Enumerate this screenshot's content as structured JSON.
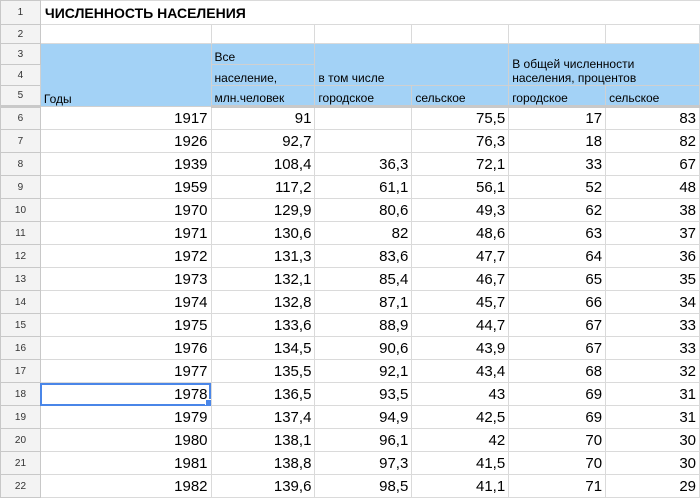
{
  "title": "ЧИСЛЕННОСТЬ НАСЕЛЕНИЯ",
  "row_numbers": [
    "1",
    "2",
    "3",
    "4",
    "5",
    "6",
    "7",
    "8",
    "9",
    "10",
    "11",
    "12",
    "13",
    "14",
    "15",
    "16",
    "17",
    "18",
    "19",
    "20",
    "21",
    "22"
  ],
  "headers": {
    "years": "Годы",
    "total_line1": "Все",
    "total_line2": "население,",
    "total_line3": "млн.человек",
    "incl": "в том числе",
    "urban": "городское",
    "rural": "сельское",
    "pct_line1": "В общей численности",
    "pct_line2": "населения, процентов",
    "pct_urban": "городское",
    "pct_rural": "сельское"
  },
  "rows": [
    {
      "year": "1917",
      "total": "91",
      "urban": "",
      "rural": "75,5",
      "pct_urban": "17",
      "pct_rural": "83"
    },
    {
      "year": "1926",
      "total": "92,7",
      "urban": "",
      "rural": "76,3",
      "pct_urban": "18",
      "pct_rural": "82"
    },
    {
      "year": "1939",
      "total": "108,4",
      "urban": "36,3",
      "rural": "72,1",
      "pct_urban": "33",
      "pct_rural": "67"
    },
    {
      "year": "1959",
      "total": "117,2",
      "urban": "61,1",
      "rural": "56,1",
      "pct_urban": "52",
      "pct_rural": "48"
    },
    {
      "year": "1970",
      "total": "129,9",
      "urban": "80,6",
      "rural": "49,3",
      "pct_urban": "62",
      "pct_rural": "38"
    },
    {
      "year": "1971",
      "total": "130,6",
      "urban": "82",
      "rural": "48,6",
      "pct_urban": "63",
      "pct_rural": "37"
    },
    {
      "year": "1972",
      "total": "131,3",
      "urban": "83,6",
      "rural": "47,7",
      "pct_urban": "64",
      "pct_rural": "36"
    },
    {
      "year": "1973",
      "total": "132,1",
      "urban": "85,4",
      "rural": "46,7",
      "pct_urban": "65",
      "pct_rural": "35"
    },
    {
      "year": "1974",
      "total": "132,8",
      "urban": "87,1",
      "rural": "45,7",
      "pct_urban": "66",
      "pct_rural": "34"
    },
    {
      "year": "1975",
      "total": "133,6",
      "urban": "88,9",
      "rural": "44,7",
      "pct_urban": "67",
      "pct_rural": "33"
    },
    {
      "year": "1976",
      "total": "134,5",
      "urban": "90,6",
      "rural": "43,9",
      "pct_urban": "67",
      "pct_rural": "33"
    },
    {
      "year": "1977",
      "total": "135,5",
      "urban": "92,1",
      "rural": "43,4",
      "pct_urban": "68",
      "pct_rural": "32"
    },
    {
      "year": "1978",
      "total": "136,5",
      "urban": "93,5",
      "rural": "43",
      "pct_urban": "69",
      "pct_rural": "31"
    },
    {
      "year": "1979",
      "total": "137,4",
      "urban": "94,9",
      "rural": "42,5",
      "pct_urban": "69",
      "pct_rural": "31"
    },
    {
      "year": "1980",
      "total": "138,1",
      "urban": "96,1",
      "rural": "42",
      "pct_urban": "70",
      "pct_rural": "30"
    },
    {
      "year": "1981",
      "total": "138,8",
      "urban": "97,3",
      "rural": "41,5",
      "pct_urban": "70",
      "pct_rural": "30"
    },
    {
      "year": "1982",
      "total": "139,6",
      "urban": "98,5",
      "rural": "41,1",
      "pct_urban": "71",
      "pct_rural": "29"
    }
  ],
  "selected_cell": "A18",
  "colors": {
    "header_bg": "#a3d2f6",
    "selection": "#4a86e8",
    "grid": "#dadada",
    "row_header_bg": "#f3f3f3"
  }
}
